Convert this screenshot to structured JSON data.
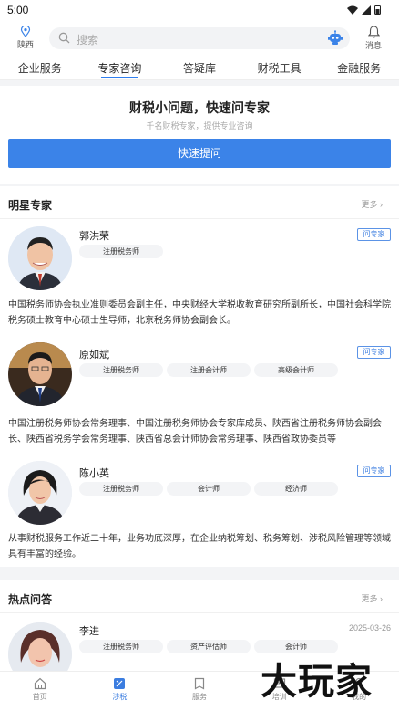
{
  "status": {
    "time": "5:00"
  },
  "header": {
    "location": "陕西",
    "search_placeholder": "搜索",
    "messages": "消息"
  },
  "tabs": [
    {
      "label": "企业服务",
      "active": false
    },
    {
      "label": "专家咨询",
      "active": true
    },
    {
      "label": "答疑库",
      "active": false
    },
    {
      "label": "财税工具",
      "active": false
    },
    {
      "label": "金融服务",
      "active": false
    }
  ],
  "ask": {
    "title": "财税小问题，快速问专家",
    "subtitle": "千名财税专家，提供专业咨询",
    "button": "快速提问"
  },
  "star_experts": {
    "title": "明星专家",
    "more": "更多",
    "items": [
      {
        "name": "郭洪荣",
        "tags": [
          "注册税务师"
        ],
        "ask": "问专家",
        "desc": "中国税务师协会执业准则委员会副主任，中央财经大学税收教育研究所副所长，中国社会科学院税务硕士教育中心硕士生导师，北京税务师协会副会长。"
      },
      {
        "name": "原如斌",
        "tags": [
          "注册税务师",
          "注册会计师",
          "高级会计师"
        ],
        "ask": "问专家",
        "desc": "中国注册税务师协会常务理事、中国注册税务师协会专家库成员、陕西省注册税务师协会副会长、陕西省税务学会常务理事、陕西省总会计师协会常务理事、陕西省政协委员等"
      },
      {
        "name": "陈小英",
        "tags": [
          "注册税务师",
          "会计师",
          "经济师"
        ],
        "ask": "问专家",
        "desc": "从事财税服务工作近二十年，业务功底深厚，在企业纳税筹划、税务筹划、涉税风险管理等领域具有丰富的经验。"
      }
    ]
  },
  "hot_qa": {
    "title": "热点问答",
    "more": "更多",
    "items": [
      {
        "name": "李进",
        "date": "2025-03-26",
        "tags": [
          "注册税务师",
          "资产评估师",
          "会计师"
        ]
      }
    ]
  },
  "bottom_nav": [
    {
      "label": "首页",
      "icon": "home-icon",
      "active": false
    },
    {
      "label": "涉税",
      "icon": "tax-icon",
      "active": true
    },
    {
      "label": "服务",
      "icon": "service-icon",
      "active": false
    },
    {
      "label": "培训",
      "icon": "training-icon",
      "active": false
    },
    {
      "label": "我的",
      "icon": "profile-icon",
      "active": false
    }
  ],
  "watermark": "大玩家",
  "colors": {
    "accent": "#3b83e8",
    "tab_underline": "#2f7ff0"
  }
}
